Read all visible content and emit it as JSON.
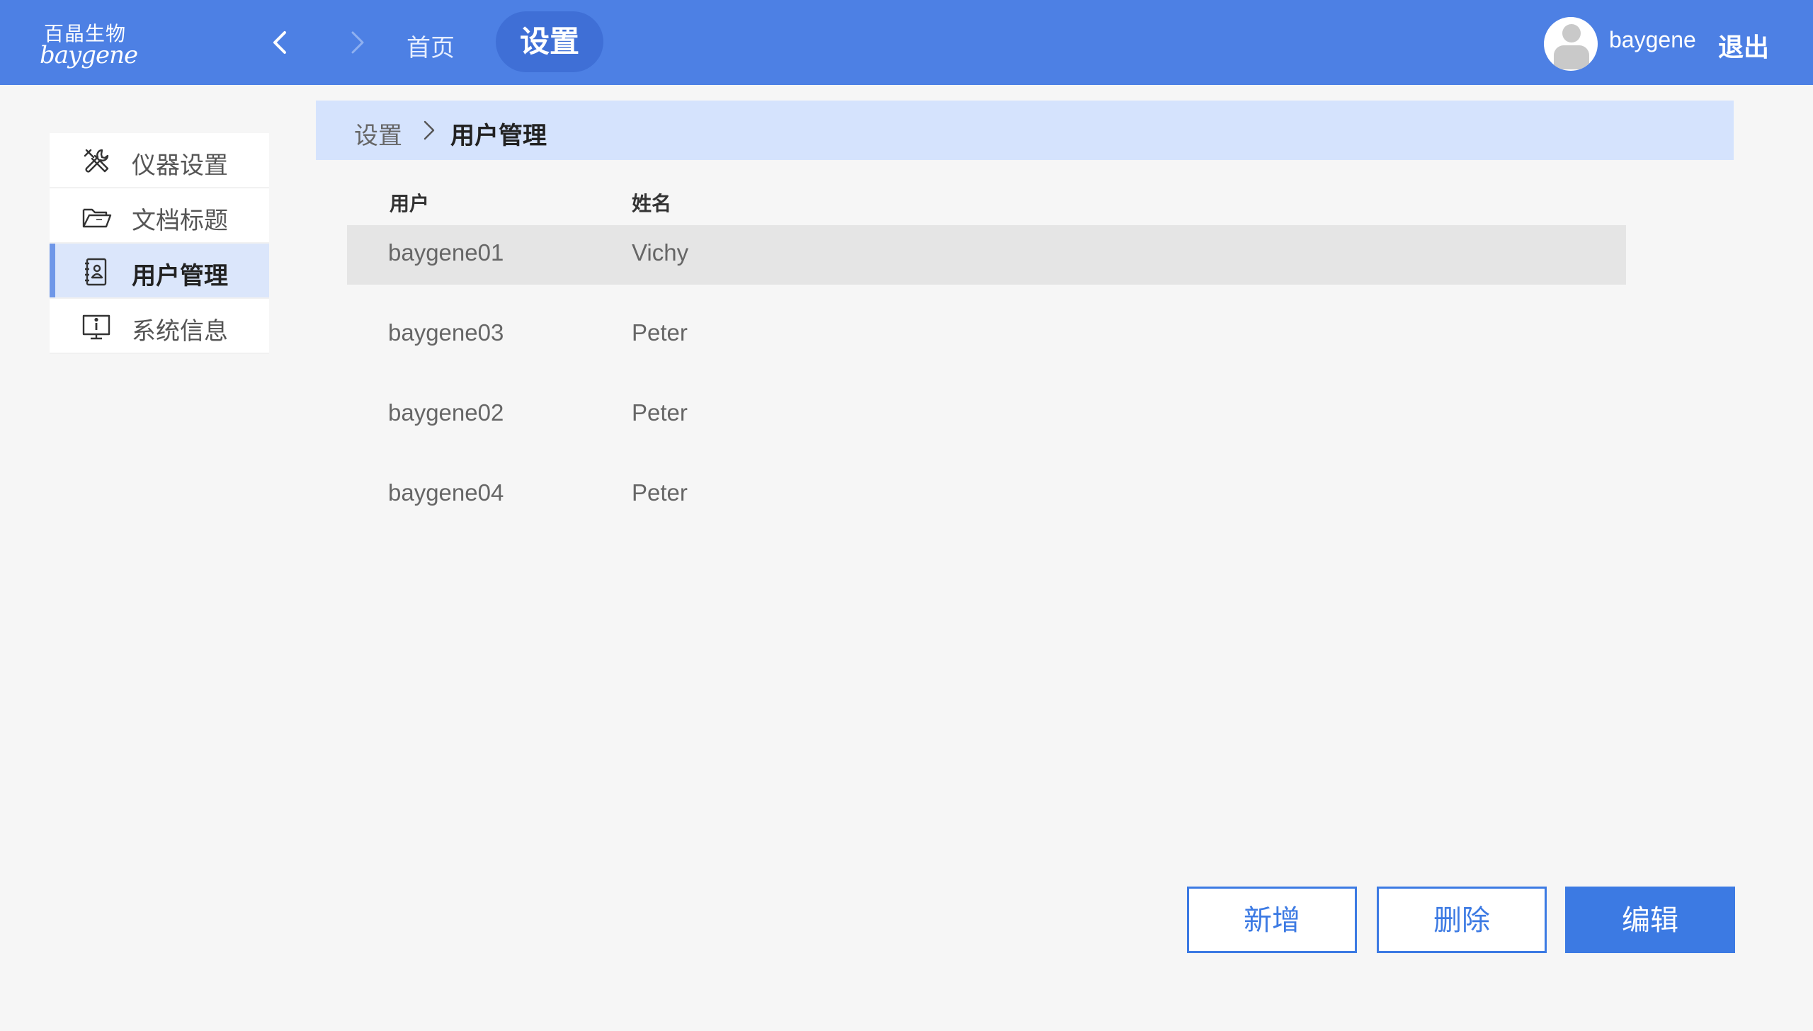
{
  "header": {
    "logo_cn": "百晶生物",
    "logo_en": "baygene",
    "nav_home": "首页",
    "nav_active": "设置",
    "username": "baygene",
    "logout": "退出"
  },
  "sidebar": {
    "items": [
      {
        "label": "仪器设置",
        "icon": "tools-icon"
      },
      {
        "label": "文档标题",
        "icon": "folder-icon"
      },
      {
        "label": "用户管理",
        "icon": "user-book-icon",
        "active": true
      },
      {
        "label": "系统信息",
        "icon": "monitor-info-icon"
      }
    ]
  },
  "breadcrumb": {
    "root": "设置",
    "current": "用户管理"
  },
  "table": {
    "columns": [
      "用户",
      "姓名"
    ],
    "rows": [
      {
        "user": "baygene01",
        "name": "Vichy",
        "selected": true
      },
      {
        "user": "baygene03",
        "name": "Peter"
      },
      {
        "user": "baygene02",
        "name": "Peter"
      },
      {
        "user": "baygene04",
        "name": "Peter"
      }
    ]
  },
  "actions": {
    "add": "新增",
    "delete": "删除",
    "edit": "编辑"
  },
  "colors": {
    "header_bg": "#4d80e4",
    "accent": "#3c7ae3",
    "breadcrumb_bg": "#d5e3fd"
  }
}
